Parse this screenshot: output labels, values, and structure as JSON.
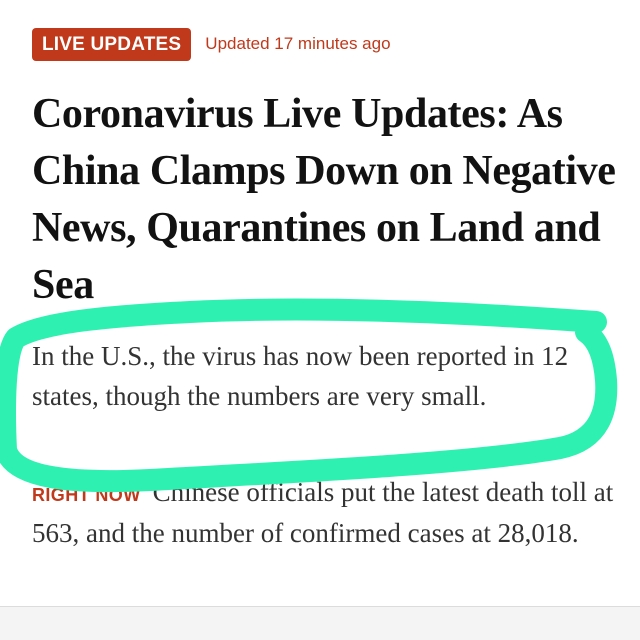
{
  "header": {
    "badge_label": "LIVE UPDATES",
    "updated_text": "Updated 17 minutes ago"
  },
  "article": {
    "headline": "Coronavirus Live Updates: As China Clamps Down on Negative News, Quarantines on Land and Sea",
    "summary": "In the U.S., the virus has now been reported in 12 states, though the numbers are very small.",
    "update_label": "RIGHT NOW",
    "update_text": "Chinese officials put the latest death toll at 563, and the number of confirmed cases at 28,018."
  },
  "colors": {
    "accent": "#c0391b",
    "highlighter": "#2ef0b0",
    "text": "#121212"
  },
  "annotation": {
    "type": "hand-drawn-highlight-loop",
    "color_name": "mint-green"
  }
}
